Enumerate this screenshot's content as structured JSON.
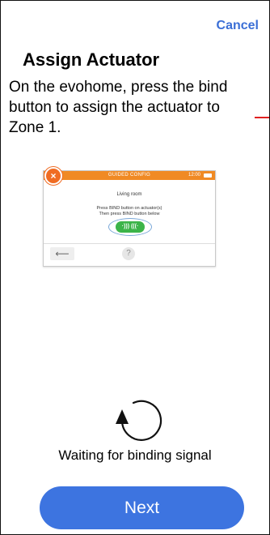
{
  "header": {
    "cancel_label": "Cancel"
  },
  "page": {
    "title": "Assign Actuator",
    "instructions": "On the evohome, press the bind button to assign the actuator to Zone 1."
  },
  "device_illustration": {
    "header_title": "GUIDED CONFIG",
    "time": "12:00",
    "room": "Living room",
    "line1": "Press BIND button on actuator(s)",
    "line2": "Then press BIND button below",
    "bind_symbol": "·))) (((·",
    "back_symbol": "⟵",
    "help_symbol": "?",
    "accent_color": "#f08a24",
    "bind_color": "#3cb449"
  },
  "status": {
    "icon": "refresh-spinner-icon",
    "text": "Waiting for binding signal"
  },
  "footer": {
    "next_label": "Next",
    "button_color": "#3d74e0"
  }
}
